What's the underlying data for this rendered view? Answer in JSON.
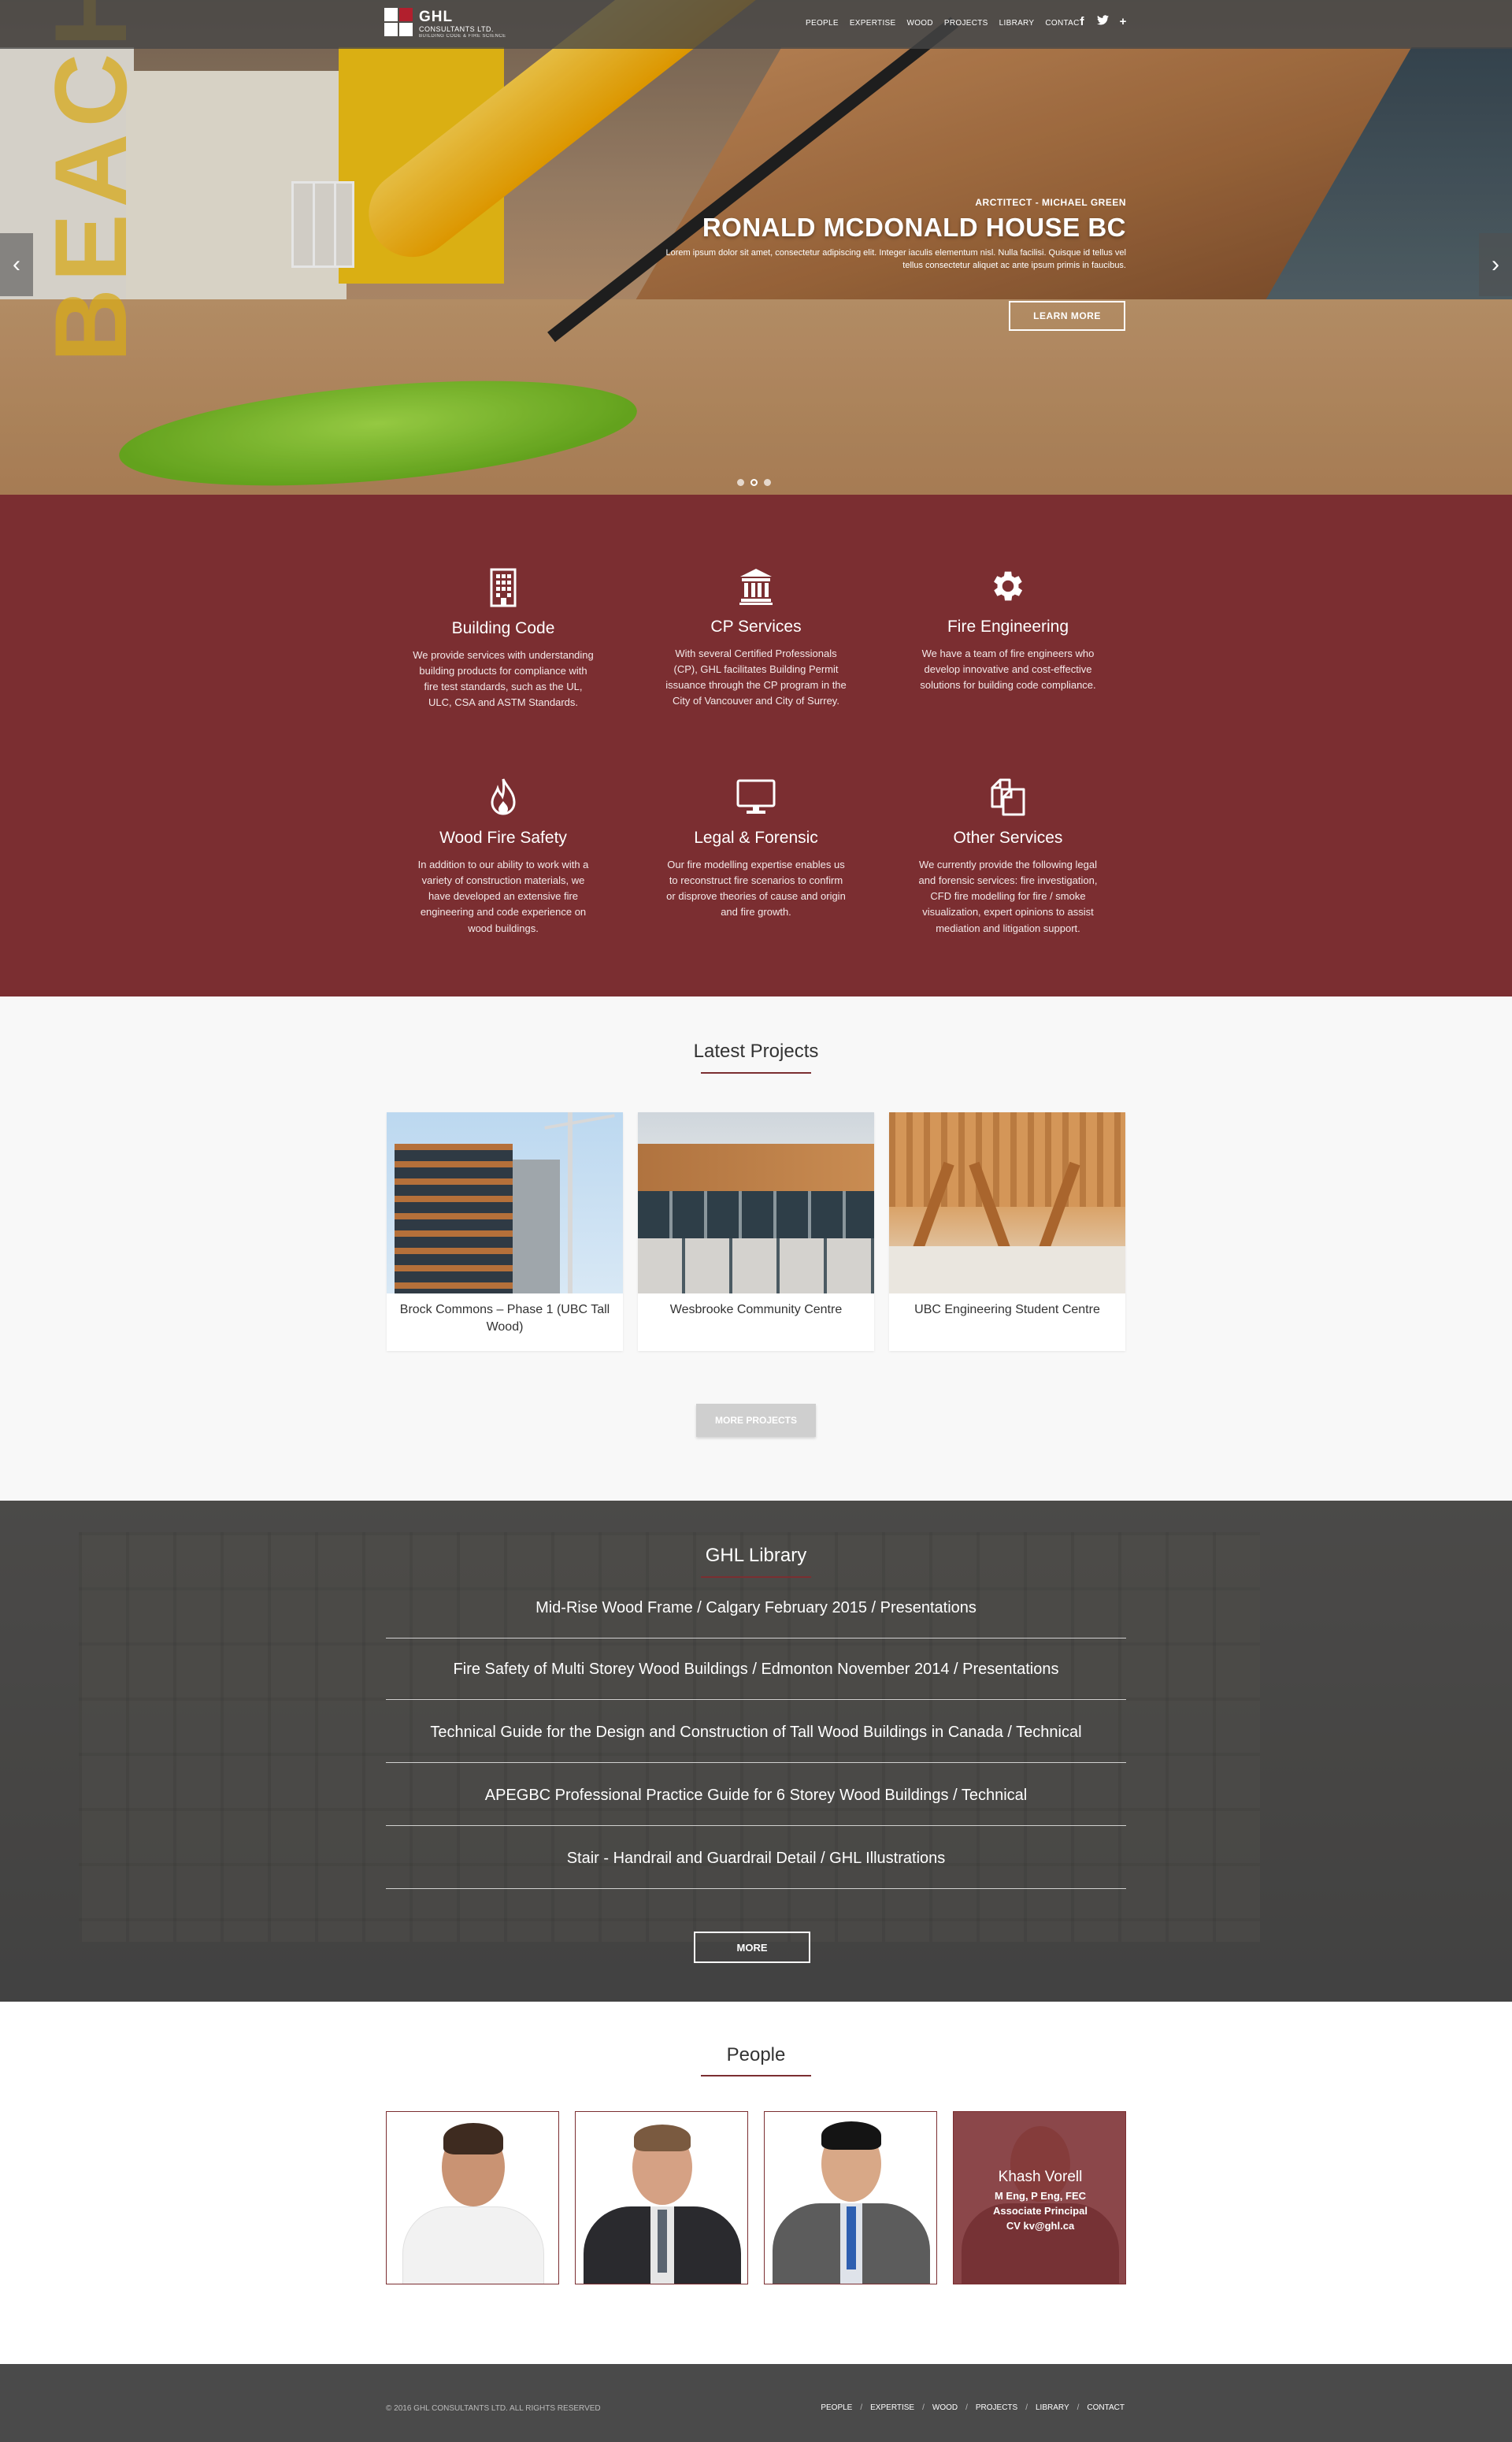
{
  "header": {
    "logo_line1": "GHL",
    "logo_line2": "CONSULTANTS LTD.",
    "logo_line3": "BUILDING CODE & FIRE SCIENCE",
    "nav": [
      "PEOPLE",
      "EXPERTISE",
      "WOOD",
      "PROJECTS",
      "LIBRARY",
      "CONTACT"
    ],
    "social": [
      "facebook-icon",
      "twitter-icon",
      "plus-icon"
    ]
  },
  "hero": {
    "kicker": "ARCTITECT - MICHAEL GREEN",
    "title": "RONALD MCDONALD HOUSE BC",
    "desc": "Lorem ipsum dolor sit amet, consectetur adipiscing elit. Integer iaculis elementum nisl. Nulla facilisi. Quisque id tellus vel tellus consectetur aliquet ac ante ipsum primis in faucibus.",
    "button": "LEARN MORE",
    "slides": 3,
    "active_slide": 2,
    "watermark": "BEACH"
  },
  "services": [
    {
      "name": "Building Code",
      "icon": "building-icon",
      "text": "We provide services with understanding building products for compliance with fire test standards, such as the UL, ULC, CSA and ASTM Standards."
    },
    {
      "name": "CP Services",
      "icon": "bank-icon",
      "text": "With several Certified Professionals (CP), GHL facilitates Building Permit issuance through the CP program in the City of Vancouver and City of Surrey."
    },
    {
      "name": "Fire Engineering",
      "icon": "gear-icon",
      "text": "We have a team of fire engineers who develop innovative and cost-effective solutions for building code compliance."
    },
    {
      "name": "Wood Fire Safety",
      "icon": "flame-icon",
      "text": "In addition to our ability to work with a variety of construction materials, we have developed an extensive fire engineering and code experience on wood buildings."
    },
    {
      "name": "Legal & Forensic",
      "icon": "monitor-icon",
      "text": "Our fire modelling expertise enables us to reconstruct fire scenarios to confirm or disprove theories of cause and origin and fire growth."
    },
    {
      "name": "Other Services",
      "icon": "copy-icon",
      "text": "We currently provide the following legal and forensic services: fire investigation, CFD fire modelling for fire / smoke visualization, expert opinions to assist mediation and litigation support."
    }
  ],
  "projects": {
    "title": "Latest Projects",
    "items": [
      {
        "caption": "Brock Commons – Phase 1 (UBC Tall Wood)"
      },
      {
        "caption": "Wesbrooke Community Centre"
      },
      {
        "caption": "UBC Engineering Student Centre"
      }
    ],
    "more": "MORE PROJECTS"
  },
  "library": {
    "title": "GHL Library",
    "items": [
      "Mid-Rise Wood Frame / Calgary February 2015 / Presentations",
      "Fire Safety of Multi Storey Wood Buildings / Edmonton November 2014 / Presentations",
      "Technical Guide for the Design and Construction of Tall Wood Buildings in Canada / Technical",
      "APEGBC Professional Practice Guide for 6 Storey Wood Buildings / Technical",
      "Stair - Handrail and Guardrail Detail / GHL Illustrations"
    ],
    "more": "MORE"
  },
  "people": {
    "title": "People",
    "highlight": {
      "name": "Khash Vorell",
      "line1": "M Eng, P Eng, FEC",
      "line2": "Associate Principal",
      "line3": "CV kv@ghl.ca"
    }
  },
  "footer": {
    "copyright": "© 2016 GHL CONSULTANTS LTD. ALL RIGHTS RESERVED",
    "nav": [
      "PEOPLE",
      "EXPERTISE",
      "WOOD",
      "PROJECTS",
      "LIBRARY",
      "CONTACT"
    ]
  },
  "colors": {
    "brand": "#7b2e31",
    "accent_red": "#b21f2d",
    "header": "#464646",
    "footer": "#4a4a4a"
  }
}
